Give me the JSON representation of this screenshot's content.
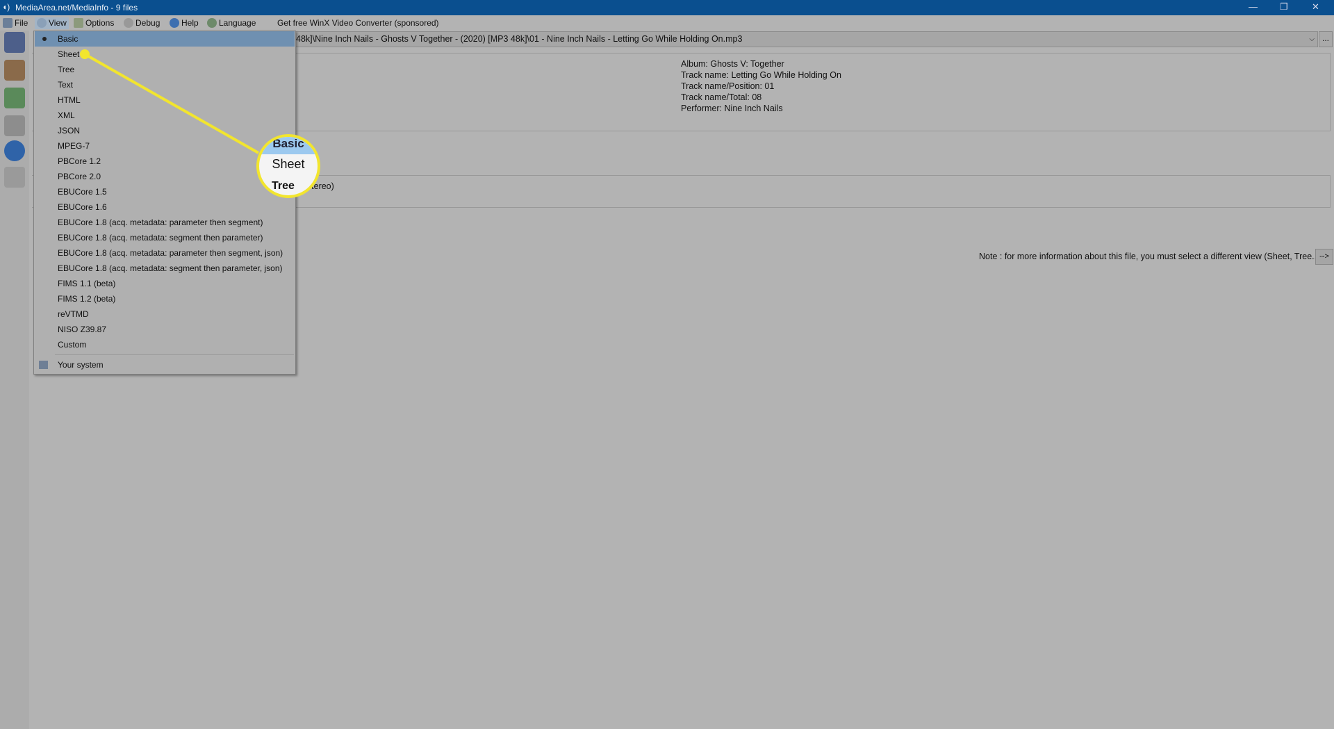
{
  "window": {
    "title": "MediaArea.net/MediaInfo - 9 files"
  },
  "menubar": {
    "items": [
      {
        "label": "File",
        "icon": "file-icon"
      },
      {
        "label": "View",
        "icon": "view-icon"
      },
      {
        "label": "Options",
        "icon": "options-icon"
      },
      {
        "label": "Debug",
        "icon": "debug-icon"
      },
      {
        "label": "Help",
        "icon": "help-icon"
      },
      {
        "label": "Language",
        "icon": "globe-icon"
      }
    ],
    "sponsored": "Get free WinX Video Converter (sponsored)"
  },
  "file_path": "48k]\\Nine Inch Nails - Ghosts V  Together - (2020) [MP3 48k]\\01 - Nine Inch Nails - Letting Go While Holding On.mp3",
  "browse_label": "...",
  "general": [
    "Album: Ghosts V: Together",
    "Track name: Letting Go While Holding On",
    "Track name/Position: 01",
    "Track name/Total: 08",
    "Performer: Nine Inch Nails"
  ],
  "audio_fragment": "nt stereo)",
  "note": "Note : for more information about this file, you must select a different view (Sheet, Tree...)",
  "note_button": "-->",
  "view_menu": {
    "selected": "Basic",
    "items": [
      "Basic",
      "Sheet",
      "Tree",
      "Text",
      "HTML",
      "XML",
      "JSON",
      "MPEG-7",
      "PBCore 1.2",
      "PBCore 2.0",
      "EBUCore 1.5",
      "EBUCore 1.6",
      "EBUCore 1.8 (acq. metadata: parameter then segment)",
      "EBUCore 1.8 (acq. metadata: segment then parameter)",
      "EBUCore 1.8 (acq. metadata: parameter then segment, json)",
      "EBUCore 1.8 (acq. metadata: segment then parameter, json)",
      "FIMS 1.1 (beta)",
      "FIMS 1.2 (beta)",
      "reVTMD",
      "NISO Z39.87",
      "Custom"
    ],
    "system": "Your system"
  },
  "callout": {
    "above": "Basic",
    "focus": "Sheet",
    "below": "Tree",
    "color": "#f2e52e"
  }
}
